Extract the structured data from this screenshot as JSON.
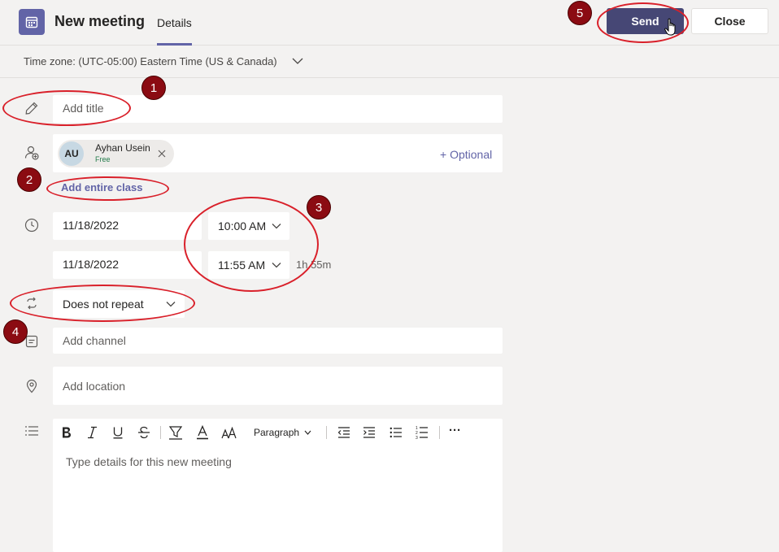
{
  "header": {
    "title": "New meeting",
    "tab_details": "Details",
    "send_label": "Send",
    "close_label": "Close"
  },
  "timezone": {
    "label": "Time zone: (UTC-05:00) Eastern Time (US & Canada)"
  },
  "form": {
    "title_placeholder": "Add title",
    "attendee": {
      "initials": "AU",
      "name": "Ayhan Usein",
      "status": "Free"
    },
    "optional_label": "+ Optional",
    "add_class_label": "Add entire class",
    "start_date": "11/18/2022",
    "start_time": "10:00 AM",
    "end_date": "11/18/2022",
    "end_time": "11:55 AM",
    "duration": "1h 55m",
    "repeat": "Does not repeat",
    "channel_placeholder": "Add channel",
    "location_placeholder": "Add location",
    "editor": {
      "paragraph_label": "Paragraph",
      "more_label": "···",
      "placeholder": "Type details for this new meeting"
    }
  },
  "annotations": {
    "badge_1": "1",
    "badge_2": "2",
    "badge_3": "3",
    "badge_4": "4",
    "badge_5": "5"
  },
  "colors": {
    "accent": "#6264a7",
    "send_bg": "#464775",
    "annotation_red": "#d9202a",
    "badge_bg": "#8b0b12"
  }
}
